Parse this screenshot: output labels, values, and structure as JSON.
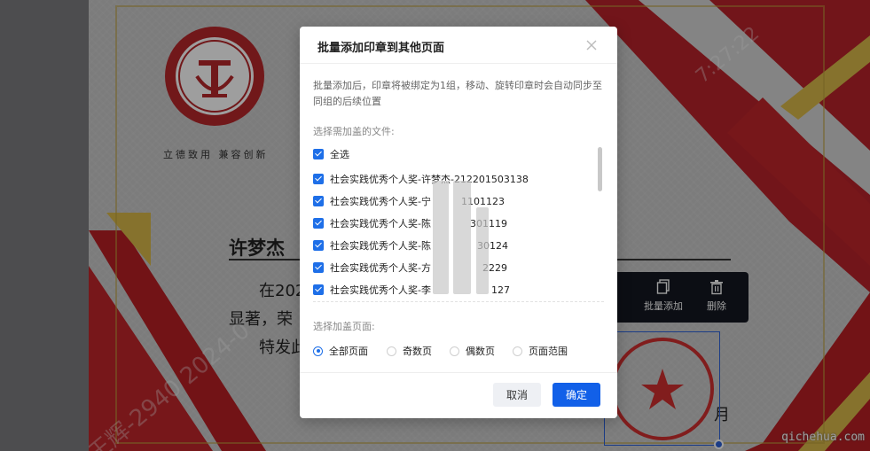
{
  "document": {
    "university_motto": "立德致用 兼容创新",
    "logo_text": "JIANGHAN UNIVERSITY",
    "recipient_name": "许梦杰",
    "body_line1": "在202",
    "body_line2": "显著，荣",
    "body_line3": "特发此",
    "watermark_user": "王辉-2940 2024-0",
    "watermark_time": "7:27:22",
    "stamp_text": "江汉大学教务测试1号",
    "partial_char": "月"
  },
  "seal_toolbar": {
    "items": [
      {
        "label": "",
        "icon": "edit-icon"
      },
      {
        "label": "批量添加",
        "icon": "copy-icon"
      },
      {
        "label": "删除",
        "icon": "trash-icon"
      }
    ]
  },
  "dialog": {
    "title": "批量添加印章到其他页面",
    "description": "批量添加后，印章将被绑定为1组，移动、旋转印章时会自动同步至同组的后续位置",
    "files_label": "选择需加盖的文件:",
    "select_all": "全选",
    "files": [
      "社会实践优秀个人奖-许梦杰-212201503138",
      "社会实践优秀个人奖-宁",
      "社会实践优秀个人奖-陈",
      "社会实践优秀个人奖-陈",
      "社会实践优秀个人奖-方",
      "社会实践优秀个人奖-李"
    ],
    "file_suffixes": [
      "",
      "1101123",
      "301119",
      "30124",
      "2229",
      "127"
    ],
    "pages_label": "选择加盖页面:",
    "page_options": [
      "全部页面",
      "奇数页",
      "偶数页",
      "页面范围"
    ],
    "selected_page_option": "全部页面",
    "cancel_label": "取消",
    "confirm_label": "确定"
  },
  "site_watermark": "qichehua.com",
  "colors": {
    "primary": "#1260e8",
    "seal_red": "#b7272b",
    "toolbar_bg": "#141821"
  }
}
